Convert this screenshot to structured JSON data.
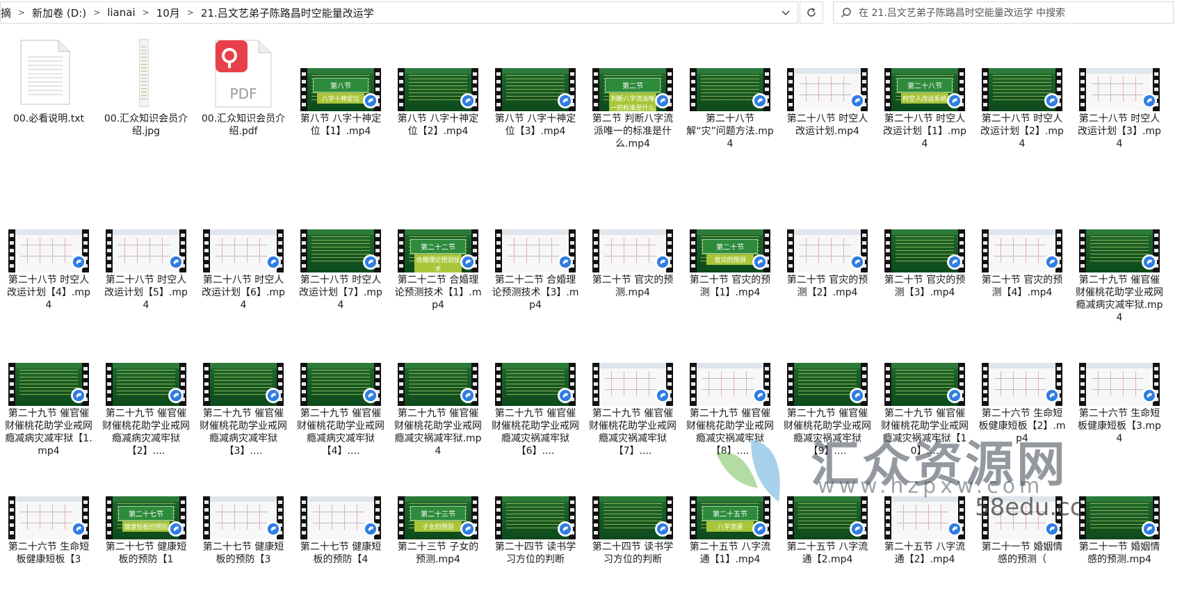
{
  "address_bar": {
    "crumbs": [
      "摘",
      "新加卷 (D:)",
      "lianai",
      "10月",
      "21.吕文艺弟子陈路昌时空能量改运学"
    ]
  },
  "search": {
    "placeholder": "在 21.吕文艺弟子陈路昌时空能量改运学 中搜索"
  },
  "files": [
    {
      "name": "00.必看说明.txt",
      "type": "txt"
    },
    {
      "name": "00.汇众知识会员介绍.jpg",
      "type": "jpg"
    },
    {
      "name": "00.汇众知识会员介绍.pdf",
      "type": "pdf",
      "icon_label": "PDF"
    },
    {
      "name": "第八节 八字十神定位【1】.mp4",
      "type": "video",
      "thumb": "green",
      "banner": "第八节",
      "sub": "八字十神定位"
    },
    {
      "name": "第八节 八字十神定位【2】.mp4",
      "type": "video",
      "thumb": "green"
    },
    {
      "name": "第八节 八字十神定位【3】.mp4",
      "type": "video",
      "thumb": "green"
    },
    {
      "name": "第二节 判断八字流派唯一的标准是什么.mp4",
      "type": "video",
      "thumb": "green",
      "banner": "第二节",
      "sub": "判断八字流派唯一的标准是什么"
    },
    {
      "name": "第二十八节 解“灾”问题方法.mp4",
      "type": "video",
      "thumb": "green"
    },
    {
      "name": "第二十八节 时空人改运计划.mp4",
      "type": "video",
      "thumb": "white"
    },
    {
      "name": "第二十八节 时空人改运计划【1】.mp4",
      "type": "video",
      "thumb": "green",
      "banner": "第二十八节",
      "sub": "时空人改运系统"
    },
    {
      "name": "第二十八节 时空人改运计划【2】.mp4",
      "type": "video",
      "thumb": "green"
    },
    {
      "name": "第二十八节 时空人改运计划【3】.mp4",
      "type": "video",
      "thumb": "white"
    },
    {
      "name": "第二十八节 时空人改运计划【4】.mp4",
      "type": "video",
      "thumb": "white"
    },
    {
      "name": "第二十八节 时空人改运计划【5】.mp4",
      "type": "video",
      "thumb": "white"
    },
    {
      "name": "第二十八节 时空人改运计划【6】.mp4",
      "type": "video",
      "thumb": "white"
    },
    {
      "name": "第二十八节 时空人改运计划【7】.mp4",
      "type": "video",
      "thumb": "green"
    },
    {
      "name": "第二十二节 合婚理论预测技术【1】.mp4",
      "type": "video",
      "thumb": "green",
      "banner": "第二十二节",
      "sub": "合婚理论预测技术"
    },
    {
      "name": "第二十二节 合婚理论预测技术【3】.mp4",
      "type": "video",
      "thumb": "white"
    },
    {
      "name": "第二十节 官灾的预测.mp4",
      "type": "video",
      "thumb": "white"
    },
    {
      "name": "第二十节 官灾的预测【1】.mp4",
      "type": "video",
      "thumb": "green",
      "banner": "第二十节",
      "sub": "官灾的预测"
    },
    {
      "name": "第二十节 官灾的预测【2】.mp4",
      "type": "video",
      "thumb": "white"
    },
    {
      "name": "第二十节 官灾的预测【3】.mp4",
      "type": "video",
      "thumb": "green"
    },
    {
      "name": "第二十节 官灾的预测【4】.mp4",
      "type": "video",
      "thumb": "white"
    },
    {
      "name": "第二十九节 催官催财催桃花助学业戒网瘾减病灾减牢狱.mp4",
      "type": "video",
      "thumb": "green"
    },
    {
      "name": "第二十九节 催官催财催桃花助学业戒网瘾减病灾减牢狱【1.mp4",
      "type": "video",
      "thumb": "green"
    },
    {
      "name": "第二十九节 催官催财催桃花助学业戒网瘾减病灾减牢狱【2】....",
      "type": "video",
      "thumb": "green"
    },
    {
      "name": "第二十九节 催官催财催桃花助学业戒网瘾减病灾减牢狱【3】....",
      "type": "video",
      "thumb": "green"
    },
    {
      "name": "第二十九节 催官催财催桃花助学业戒网瘾减病灾减牢狱【4】....",
      "type": "video",
      "thumb": "green"
    },
    {
      "name": "第二十九节 催官催财催桃花助学业戒网瘾减灾祸减牢狱.mp4",
      "type": "video",
      "thumb": "green"
    },
    {
      "name": "第二十九节 催官催财催桃花助学业戒网瘾减灾祸减牢狱【6】....",
      "type": "video",
      "thumb": "green"
    },
    {
      "name": "第二十九节 催官催财催桃花助学业戒网瘾减灾祸减牢狱【7】....",
      "type": "video",
      "thumb": "white"
    },
    {
      "name": "第二十九节 催官催财催桃花助学业戒网瘾减灾祸减牢狱【8】....",
      "type": "video",
      "thumb": "white"
    },
    {
      "name": "第二十九节 催官催财催桃花助学业戒网瘾减灾祸减牢狱【9】....",
      "type": "video",
      "thumb": "green"
    },
    {
      "name": "第二十九节 催官催财催桃花助学业戒网瘾减灾祸减牢狱【10】....",
      "type": "video",
      "thumb": "green"
    },
    {
      "name": "第二十六节 生命短板健康短板【2】.mp4",
      "type": "video",
      "thumb": "white"
    },
    {
      "name": "第二十六节 生命短板健康短板【3.mp4",
      "type": "video",
      "thumb": "white"
    },
    {
      "name": "第二十六节 生命短板健康短板【3",
      "type": "video",
      "thumb": "white"
    },
    {
      "name": "第二十七节 健康短板的预防【1",
      "type": "video",
      "thumb": "green",
      "banner": "第二十七节",
      "sub": "健康短板的预防"
    },
    {
      "name": "第二十七节 健康短板的预防【3",
      "type": "video",
      "thumb": "white"
    },
    {
      "name": "第二十七节 健康短板的预防【4",
      "type": "video",
      "thumb": "white"
    },
    {
      "name": "第二十三节 子女的预测.mp4",
      "type": "video",
      "thumb": "green",
      "banner": "第二十三节",
      "sub": "子女的预测"
    },
    {
      "name": "第二十四节 读书学习方位的判断",
      "type": "video",
      "thumb": "green"
    },
    {
      "name": "第二十四节 读书学习方位的判断",
      "type": "video",
      "thumb": "green"
    },
    {
      "name": "第二十五节 八字流通【1】.mp4",
      "type": "video",
      "thumb": "green",
      "banner": "第二十五节",
      "sub": "八字流通"
    },
    {
      "name": "第二十五节 八字流通【2.mp4",
      "type": "video",
      "thumb": "green"
    },
    {
      "name": "第二十五节 八字流通【2】.mp4",
      "type": "video",
      "thumb": "white"
    },
    {
      "name": "第二十一节 婚姻情感的预测（",
      "type": "video",
      "thumb": "white"
    },
    {
      "name": "第二十一节 婚姻情感的预测.mp4",
      "type": "video",
      "thumb": "green"
    }
  ],
  "watermark": {
    "brand": "汇众资源网",
    "url": "www.hzpxw.com",
    "site": "58edu.cc"
  },
  "colors": {
    "border": "#d9d9d9",
    "thumb_green": "#1f6b2e",
    "play_blue": "#2f7de1"
  }
}
